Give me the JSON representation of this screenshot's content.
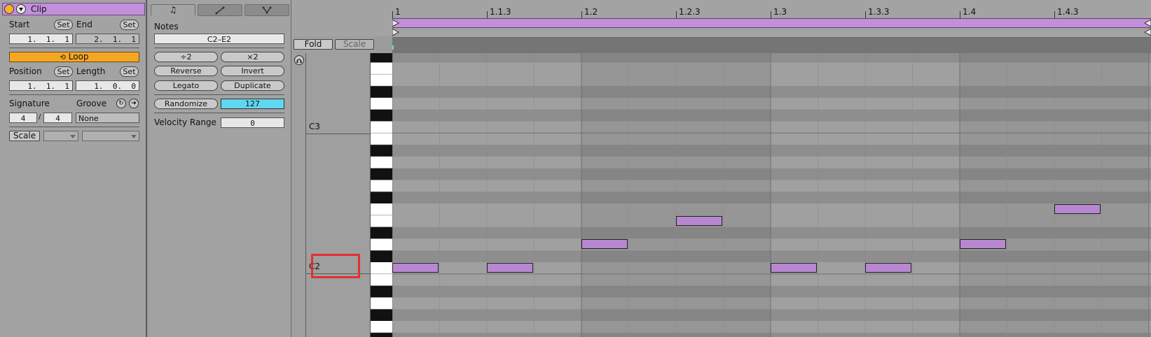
{
  "clip": {
    "title": "Clip",
    "start_label": "Start",
    "end_label": "End",
    "set_label": "Set",
    "start_value": "1.  1.  1",
    "end_value": "2.  1.  1",
    "loop_label": "Loop",
    "position_label": "Position",
    "length_label": "Length",
    "position_value": "1.  1.  1",
    "length_value": "1.  0.  0",
    "signature_label": "Signature",
    "groove_label": "Groove",
    "sig_num": "4",
    "sig_sep": "/",
    "sig_den": "4",
    "groove_value": "None",
    "scale_label": "Scale",
    "colors": {
      "header": "#c28fdb",
      "loop": "#f5a623"
    }
  },
  "notes": {
    "tabs": [
      "note-icon",
      "envelope-icon",
      "branch-icon"
    ],
    "title": "Notes",
    "range": "C2–E2",
    "div2": "÷2",
    "mul2": "×2",
    "reverse": "Reverse",
    "invert": "Invert",
    "legato": "Legato",
    "duplicate": "Duplicate",
    "randomize": "Randomize",
    "velocity": "127",
    "velocity_range_label": "Velocity Range",
    "velocity_range_value": "0",
    "colors": {
      "velocity": "#5fd7f0"
    }
  },
  "editor": {
    "fold_label": "Fold",
    "scale_label": "Scale",
    "c3_label": "C3",
    "c2_label": "C2",
    "ruler": [
      "1",
      "1.1.3",
      "1.2",
      "1.2.3",
      "1.3",
      "1.3.3",
      "1.4",
      "1.4.3"
    ]
  },
  "notes_in_clip": [
    {
      "start": 0,
      "pitch": "C2"
    },
    {
      "start": 0.5,
      "pitch": "C2"
    },
    {
      "start": 1,
      "pitch": "D2"
    },
    {
      "start": 1.5,
      "pitch": "E2"
    },
    {
      "start": 2,
      "pitch": "C2"
    },
    {
      "start": 2.5,
      "pitch": "C2"
    },
    {
      "start": 3,
      "pitch": "D2"
    },
    {
      "start": 3.5,
      "pitch": "F2"
    }
  ]
}
